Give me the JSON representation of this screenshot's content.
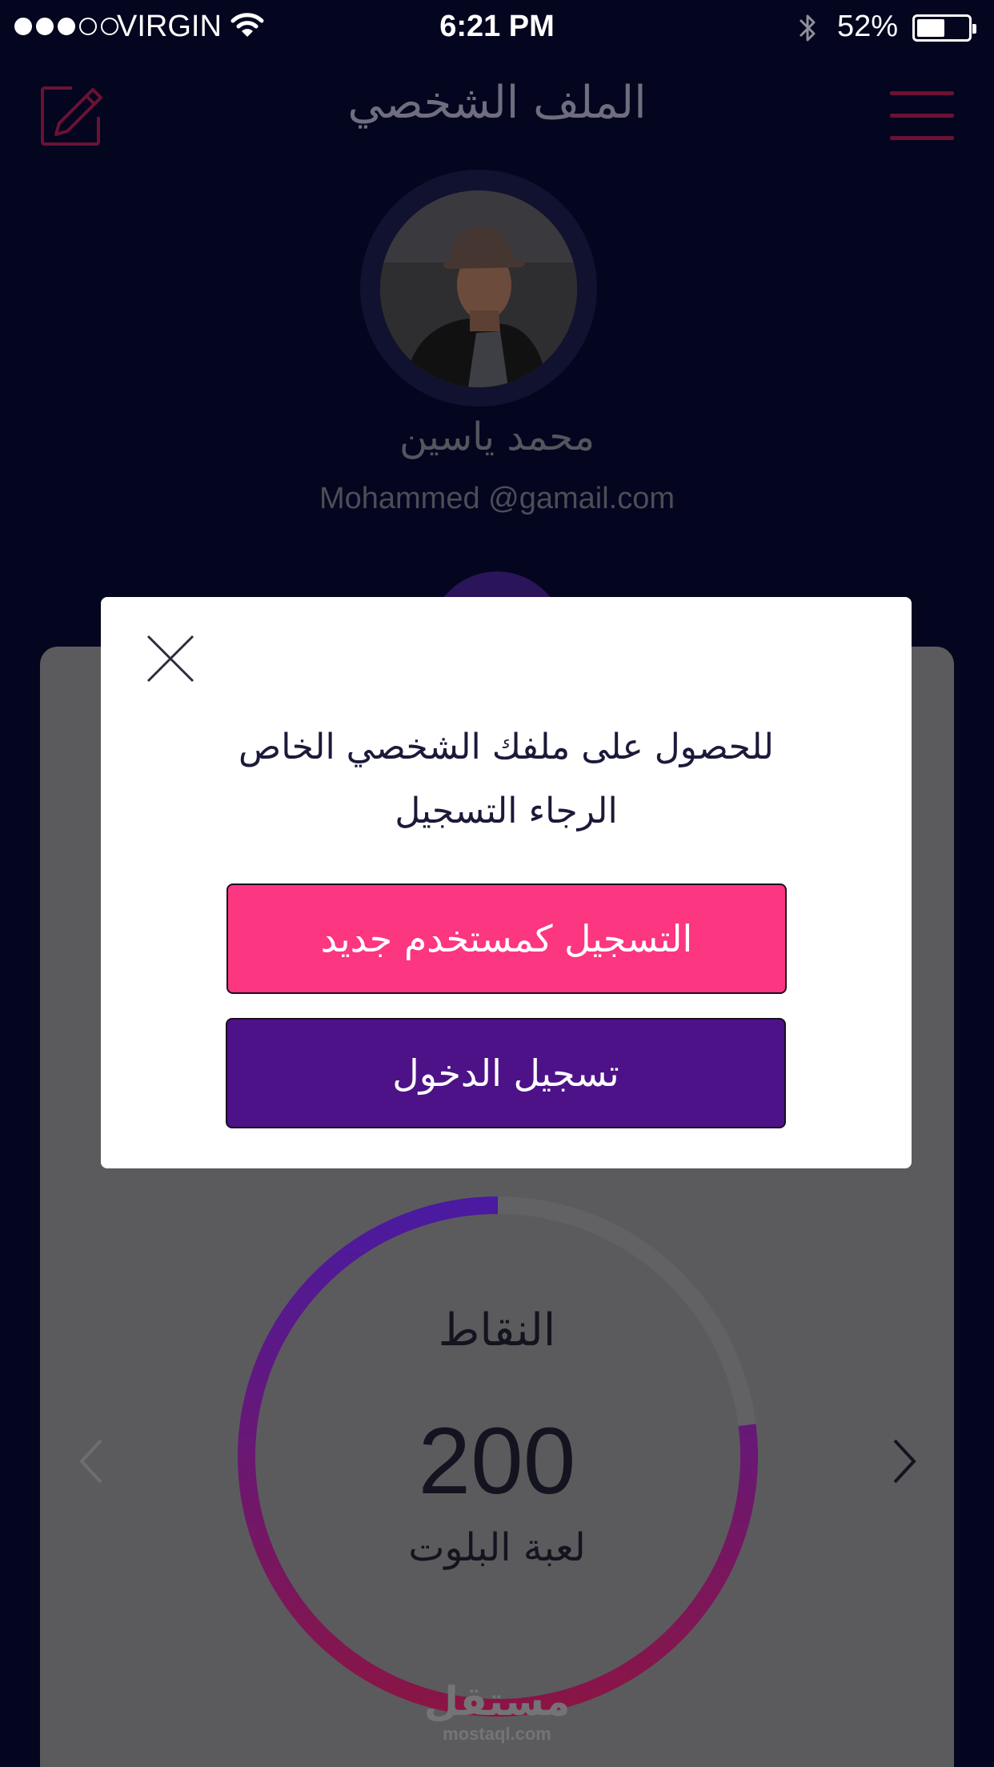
{
  "status_bar": {
    "carrier": "VIRGIN",
    "time": "6:21 PM",
    "battery": "52%",
    "signal_bars_filled": 3,
    "signal_bars_total": 5
  },
  "header": {
    "title": "الملف الشخصي",
    "edit_icon": "edit-icon",
    "menu_icon": "hamburger-menu-icon"
  },
  "profile": {
    "name": "محمد ياسين",
    "email": "Mohammed @gamail.com"
  },
  "stats": {
    "title": "النقاط",
    "value": "200",
    "game": "لعبة البلوت",
    "progress_fraction": 0.77
  },
  "modal": {
    "message_line1": "للحصول على ملفك الشخصي الخاص",
    "message_line2": "الرجاء التسجيل",
    "register_label": "التسجيل كمستخدم جديد",
    "login_label": "تسجيل الدخول",
    "close_icon": "close-icon"
  },
  "watermark": {
    "logo": "مستقل",
    "url": "mostaql.com"
  },
  "colors": {
    "background": "#04051f",
    "accent_pink": "#fc3681",
    "accent_purple": "#4d1287",
    "ring_start": "#4a1aa0",
    "ring_end": "#8a1545"
  }
}
